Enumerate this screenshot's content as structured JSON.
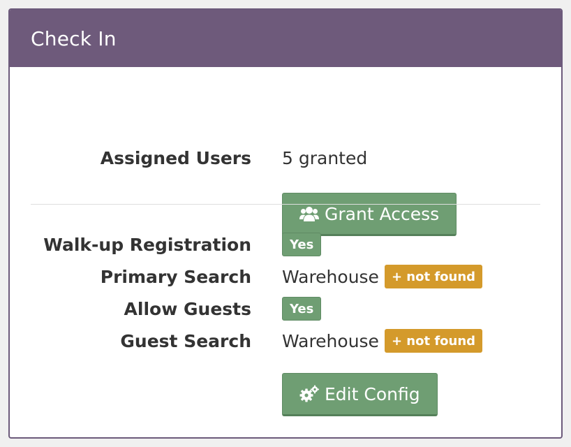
{
  "panel": {
    "title": "Check In"
  },
  "access": {
    "label": "Assigned Users",
    "value": "5 granted",
    "button_label": "Grant Access",
    "button_icon": "users-icon"
  },
  "config": {
    "walkup_label": "Walk-up Registration",
    "walkup_value": "Yes",
    "primary_search_label": "Primary Search",
    "primary_search_value": "Warehouse",
    "primary_search_badge": "+ not found",
    "allow_guests_label": "Allow Guests",
    "allow_guests_value": "Yes",
    "guest_search_label": "Guest Search",
    "guest_search_value": "Warehouse",
    "guest_search_badge": "+ not found",
    "button_label": "Edit Config",
    "button_icon": "gears-icon"
  },
  "colors": {
    "header": "#6e5a7b",
    "success": "#6f9e73",
    "warning": "#d49a2b"
  }
}
